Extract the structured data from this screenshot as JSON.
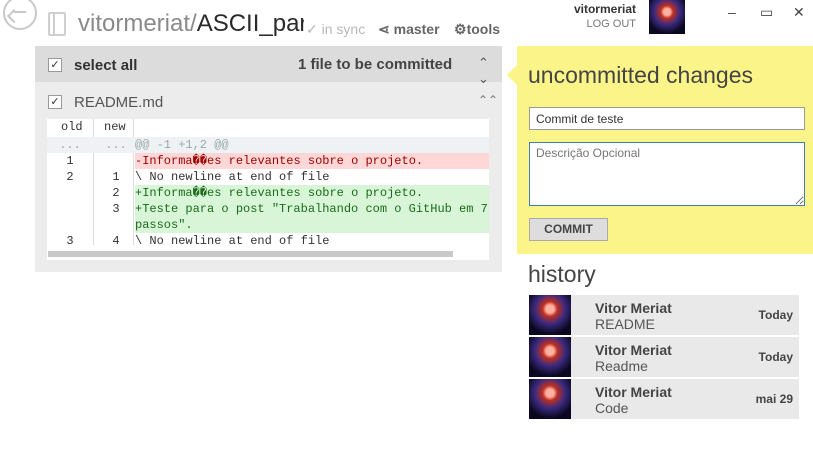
{
  "header": {
    "repo_owner": "vitormeriat/",
    "repo_name": "ASCII_par",
    "sync": "in sync",
    "branch": "master",
    "tools": "tools"
  },
  "user": {
    "name": "vitormeriat",
    "logout": "LOG OUT"
  },
  "window": {
    "min": "–",
    "max": "▭",
    "close": "✕"
  },
  "changes": {
    "select_all": "select all",
    "count": "1 file to be committed",
    "file": "README.md",
    "col_old": "old",
    "col_new": "new",
    "rows": [
      {
        "type": "hunk",
        "old": "...",
        "new": "...",
        "text": "@@ -1 +1,2 @@"
      },
      {
        "type": "del",
        "old": "1",
        "new": "",
        "text": "-Informa��es relevantes sobre o projeto."
      },
      {
        "type": "ctx",
        "old": "2",
        "new": "1",
        "text": "\\ No newline at end of file"
      },
      {
        "type": "add",
        "old": "",
        "new": "2",
        "text": "+Informa��es relevantes sobre o projeto."
      },
      {
        "type": "add",
        "old": "",
        "new": "3",
        "text": "+Teste para o post \"Trabalhando com o GitHub em 7"
      },
      {
        "type": "add",
        "old": "",
        "new": "",
        "text": "passos\"."
      },
      {
        "type": "ctx",
        "old": "3",
        "new": "4",
        "text": "\\ No newline at end of file"
      }
    ]
  },
  "commit": {
    "title": "uncommitted changes",
    "message": "Commit de teste",
    "description_placeholder": "Descrição Opcional",
    "button": "COMMIT",
    "accent": "#fbf589"
  },
  "history": {
    "title": "history",
    "items": [
      {
        "author": "Vitor Meriat",
        "message": "README",
        "date": "Today"
      },
      {
        "author": "Vitor Meriat",
        "message": "Readme",
        "date": "Today"
      },
      {
        "author": "Vitor Meriat",
        "message": "Code",
        "date": "mai 29"
      }
    ]
  }
}
